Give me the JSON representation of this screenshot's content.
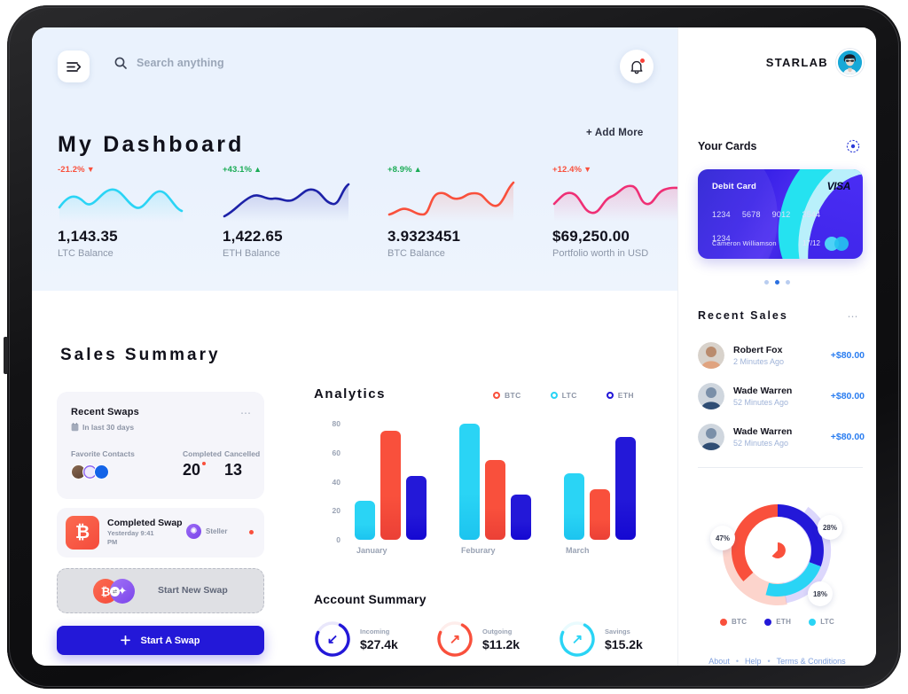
{
  "topbar": {
    "menu_icon": "menu-expand-icon",
    "search_icon": "search-icon",
    "search_placeholder": "Search anything",
    "search_value": "",
    "bell_icon": "notification-bell-icon"
  },
  "dashboard": {
    "title": "My Dashboard",
    "add_more": "+ Add More",
    "stats": [
      {
        "delta": "-21.2%",
        "direction": "down",
        "value": "1,143.35",
        "label": "LTC Balance",
        "color": "#2ad4f5",
        "delta_color": "#f9503c"
      },
      {
        "delta": "+43.1%",
        "direction": "up",
        "value": "1,422.65",
        "label": "ETH Balance",
        "color": "#1d22a8",
        "delta_color": "#1aab55"
      },
      {
        "delta": "+8.9%",
        "direction": "up",
        "value": "3.9323451",
        "label": "BTC Balance",
        "color": "#f9503c",
        "delta_color": "#1aab55"
      },
      {
        "delta": "+12.4%",
        "direction": "down",
        "value": "$69,250.00",
        "label": "Portfolio worth in USD",
        "color": "#ef2f75",
        "delta_color": "#f9503c"
      }
    ]
  },
  "sales": {
    "title": "Sales Summary",
    "recent_swaps": {
      "title": "Recent Swaps",
      "calendar_icon": "calendar-icon",
      "subtitle": "In last 30 days",
      "more_icon": "more-dots-icon",
      "favorite_label": "Favorite Contacts",
      "completed_label": "Completed",
      "completed_value": "20",
      "cancelled_label": "Cancelled",
      "cancelled_value": "13"
    },
    "completed_swap": {
      "coin_icon": "bitcoin-icon",
      "coin_glyph": "₿",
      "title": "Completed Swap",
      "subtitle": "Yesterday 9:41 PM",
      "network_icon": "stellar-icon",
      "network": "Steller"
    },
    "new_swap": {
      "label": "Start New Swap",
      "coin_a": "₿",
      "coin_b": "✦",
      "swap_icon": "swap-arrows-icon"
    },
    "start_button": {
      "label": "Start A Swap",
      "icon": "plus-icon"
    }
  },
  "analytics": {
    "title": "Analytics",
    "legend": [
      {
        "label": "BTC",
        "color": "#f9503c"
      },
      {
        "label": "LTC",
        "color": "#2ad4f5"
      },
      {
        "label": "ETH",
        "color": "#2318d8"
      }
    ]
  },
  "chart_data": [
    {
      "type": "bar",
      "title": "Analytics",
      "categories": [
        "January",
        "Feburary",
        "March"
      ],
      "series": [
        {
          "name": "LTC",
          "color": "#2ad4f5",
          "values": [
            27,
            80,
            46
          ]
        },
        {
          "name": "BTC",
          "color": "#f9503c",
          "values": [
            75,
            55,
            35
          ]
        },
        {
          "name": "ETH",
          "color": "#2318d8",
          "values": [
            44,
            31,
            71
          ]
        }
      ],
      "yticks": [
        "80",
        "60",
        "40",
        "20",
        "0"
      ],
      "ylim": [
        0,
        80
      ],
      "xlabel": "",
      "ylabel": "",
      "grid": false,
      "legend_position": "top-right"
    },
    {
      "type": "pie",
      "title": "",
      "labels": [
        "BTC",
        "ETH",
        "LTC"
      ],
      "values": [
        47,
        28,
        18
      ],
      "value_labels": [
        "47%",
        "28%",
        "18%"
      ],
      "colors": [
        "#f9503c",
        "#2318d8",
        "#2ad4f5"
      ],
      "legend_position": "bottom"
    }
  ],
  "account_summary": {
    "title": "Account Summary",
    "items": [
      {
        "label": "Incoming",
        "value": "$27.4k",
        "color": "#2318d8",
        "arrow": "↙",
        "icon": "arrow-down-left-icon"
      },
      {
        "label": "Outgoing",
        "value": "$11.2k",
        "color": "#f9503c",
        "arrow": "↗",
        "icon": "arrow-up-right-icon"
      },
      {
        "label": "Savings",
        "value": "$15.2k",
        "color": "#2ad4f5",
        "arrow": "↗",
        "icon": "arrow-up-right-icon"
      }
    ]
  },
  "sidebar": {
    "brand": "STARLAB",
    "avatar_icon": "user-avatar",
    "your_cards": {
      "title": "Your Cards",
      "add_icon": "add-card-icon"
    },
    "card": {
      "type": "Debit Card",
      "network": "VISA",
      "number_groups": [
        "1234",
        "5678",
        "9012",
        "3544",
        "1234"
      ],
      "holder": "Cameron Williamson",
      "expiry": "17/12"
    },
    "carousel": {
      "count": 3,
      "active": 1
    },
    "recent_sales": {
      "title": "Recent Sales",
      "more_icon": "more-dots-icon",
      "items": [
        {
          "name": "Robert Fox",
          "time": "2 Minutes Ago",
          "amount": "+$80.00"
        },
        {
          "name": "Wade Warren",
          "time": "52 Minutes Ago",
          "amount": "+$80.00"
        },
        {
          "name": "Wade Warren",
          "time": "52 Minutes Ago",
          "amount": "+$80.00"
        }
      ]
    },
    "footer": {
      "about": "About",
      "help": "Help",
      "terms": "Terms & Conditions",
      "sep": "•"
    }
  }
}
